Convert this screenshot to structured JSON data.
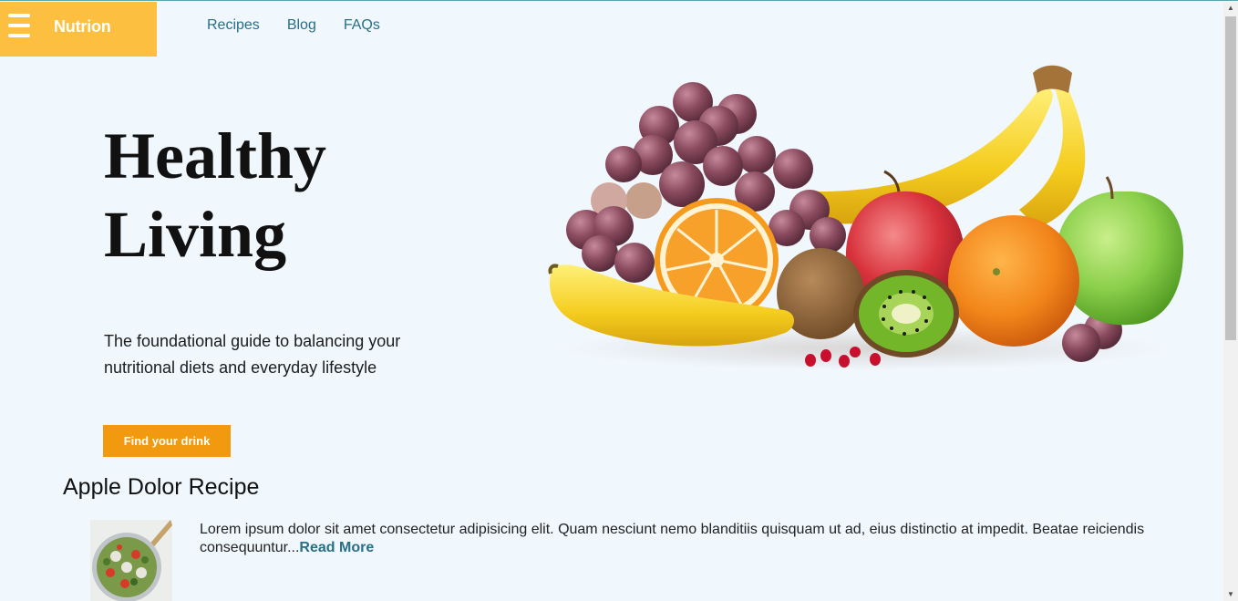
{
  "header": {
    "brand": "Nutrion",
    "menu_icon": "hamburger-menu-icon",
    "nav": [
      "Recipes",
      "Blog",
      "FAQs"
    ]
  },
  "hero": {
    "title_line1": "Healthy",
    "title_line2": "Living",
    "subtitle": "The foundational guide to balancing your nutritional diets and everyday lifestyle",
    "cta_label": "Find your drink",
    "image_alt": "fruits-illustration"
  },
  "recipe": {
    "title": "Apple Dolor Recipe",
    "excerpt": "Lorem ipsum dolor sit amet consectetur adipisicing elit. Quam nesciunt nemo blanditiis quisquam ut ad, eius distinctio at impedit. Beatae reiciendis consequuntur...",
    "read_more": "Read More"
  },
  "colors": {
    "page_bg": "#f0f7fd",
    "brand_bg": "#fdbf3f",
    "nav_link": "#286f87",
    "cta_bg": "#f29a0f"
  }
}
